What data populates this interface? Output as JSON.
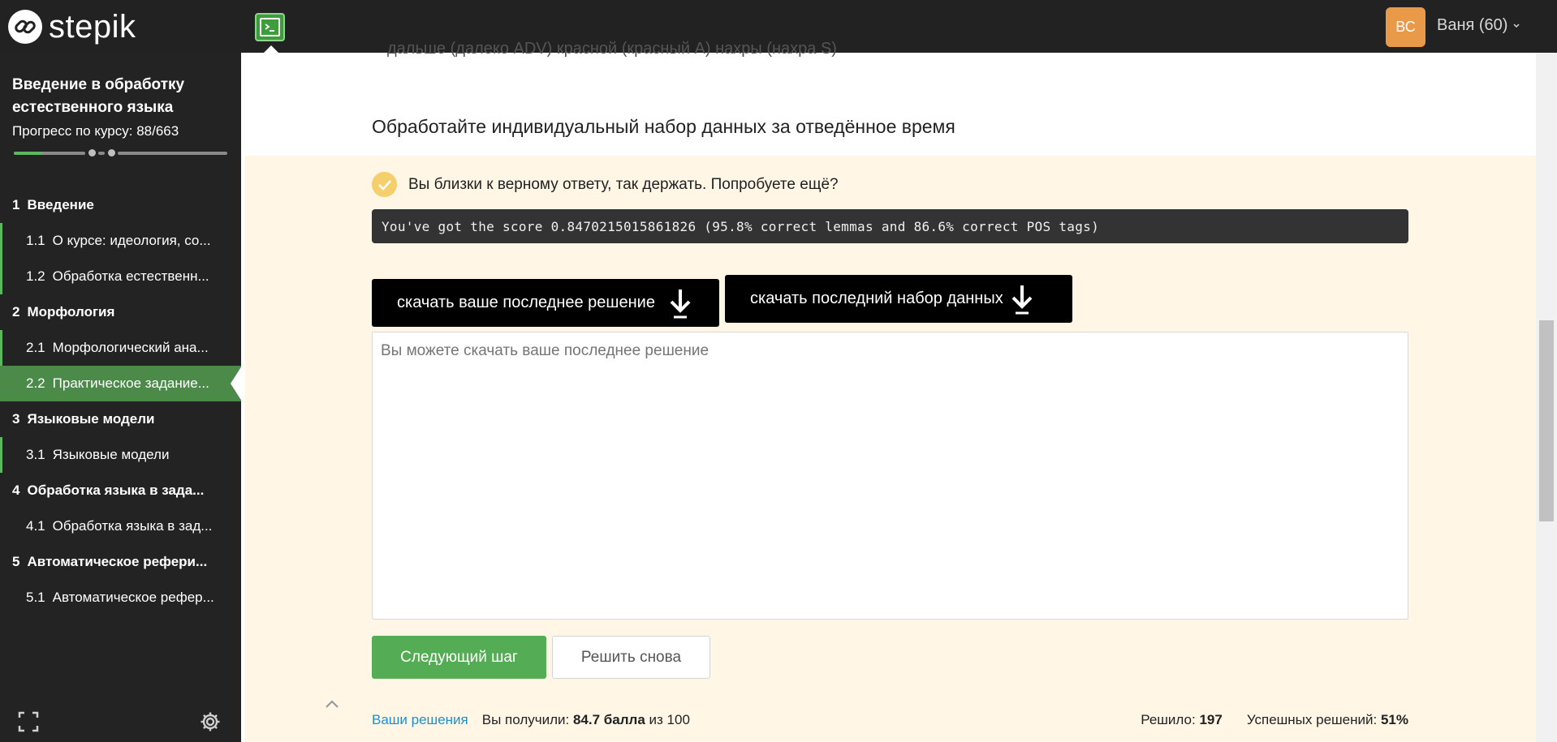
{
  "header": {
    "logo_text": "stepik",
    "avatar_initials": "ВС",
    "user_label": "Ваня (60)"
  },
  "sidebar": {
    "course_title": "Введение в обработку естественного языка",
    "progress_label": "Прогресс по курсу:",
    "progress_value": "88/663",
    "progress_fraction": 0.133,
    "items": [
      {
        "num": "1",
        "label": "Введение",
        "type": "module"
      },
      {
        "num": "1.1",
        "label": "О курсе: идеология, со...",
        "type": "lesson"
      },
      {
        "num": "1.2",
        "label": "Обработка естественн...",
        "type": "lesson"
      },
      {
        "num": "2",
        "label": "Морфология",
        "type": "module"
      },
      {
        "num": "2.1",
        "label": "Морфологический ана...",
        "type": "lesson"
      },
      {
        "num": "2.2",
        "label": "Практическое задание...",
        "type": "lesson",
        "active": true
      },
      {
        "num": "3",
        "label": "Языковые модели",
        "type": "module"
      },
      {
        "num": "3.1",
        "label": "Языковые модели",
        "type": "lesson"
      },
      {
        "num": "4",
        "label": "Обработка языка в зада...",
        "type": "module"
      },
      {
        "num": "4.1",
        "label": "Обработка языка в зад...",
        "type": "lesson"
      },
      {
        "num": "5",
        "label": "Автоматическое рефери...",
        "type": "module"
      },
      {
        "num": "5.1",
        "label": "Автоматическое рефер...",
        "type": "lesson"
      }
    ]
  },
  "main": {
    "cut_text": "дальше (далеко ADV) красной (красный A) нахры (нахра S)",
    "heading": "Обработайте индивидуальный набор данных за отведённое время",
    "status_message": "Вы близки к верному ответу, так держать. Попробуете ещё?",
    "score_text": "You've got the score 0.8470215015861826 (95.8% correct lemmas and 86.6% correct POS tags)",
    "download_solution_label": "скачать ваше последнее решение",
    "download_dataset_label": "скачать последний набор данных",
    "solution_placeholder": "Вы можете скачать ваше последнее решение",
    "next_button": "Следующий шаг",
    "retry_button": "Решить снова",
    "footer": {
      "your_solutions_link": "Ваши решения",
      "received_prefix": "Вы получили:",
      "received_points": "84.7 балла",
      "received_suffix": "из 100",
      "solved_label": "Решило:",
      "solved_value": "197",
      "success_label": "Успешных решений:",
      "success_value": "51%"
    }
  },
  "colors": {
    "topbar": "#222222",
    "sidebar": "#232323",
    "accent_green": "#54ad54",
    "active_item": "#4c8a4a",
    "result_panel": "#fff6e5",
    "avatar": "#e89a48",
    "link": "#1b8fd6"
  }
}
